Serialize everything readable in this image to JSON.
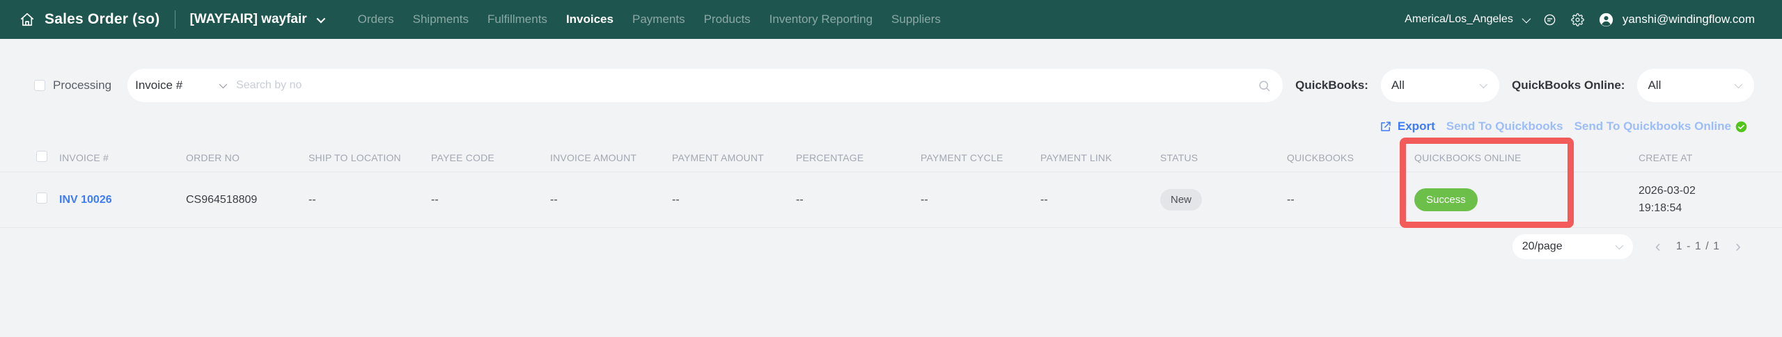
{
  "topbar": {
    "app_title": "Sales Order (so)",
    "store_selector": "[WAYFAIR] wayfair",
    "nav": [
      {
        "label": "Orders",
        "active": false
      },
      {
        "label": "Shipments",
        "active": false
      },
      {
        "label": "Fulfillments",
        "active": false
      },
      {
        "label": "Invoices",
        "active": true
      },
      {
        "label": "Payments",
        "active": false
      },
      {
        "label": "Products",
        "active": false
      },
      {
        "label": "Inventory Reporting",
        "active": false
      },
      {
        "label": "Suppliers",
        "active": false
      }
    ],
    "timezone": "America/Los_Angeles",
    "user_email": "yanshi@windingflow.com"
  },
  "filters": {
    "processing_label": "Processing",
    "search_type": "Invoice #",
    "search_placeholder": "Search by no",
    "quickbooks_label": "QuickBooks:",
    "quickbooks_value": "All",
    "quickbooks_online_label": "QuickBooks Online:",
    "quickbooks_online_value": "All"
  },
  "actions": {
    "export_label": "Export",
    "send_to_quickbooks_label": "Send To Quickbooks",
    "send_to_quickbooks_online_label": "Send To Quickbooks Online"
  },
  "table": {
    "columns": [
      "INVOICE #",
      "ORDER NO",
      "SHIP TO LOCATION",
      "PAYEE CODE",
      "INVOICE AMOUNT",
      "PAYMENT AMOUNT",
      "PERCENTAGE",
      "PAYMENT CYCLE",
      "PAYMENT LINK",
      "STATUS",
      "QUICKBOOKS",
      "QUICKBOOKS ONLINE",
      "CREATE AT"
    ],
    "rows": [
      {
        "invoice_no": "INV 10026",
        "order_no": "CS964518809",
        "ship_to_location": "--",
        "payee_code": "--",
        "invoice_amount": "--",
        "payment_amount": "--",
        "percentage": "--",
        "payment_cycle": "--",
        "payment_link": "--",
        "status": "New",
        "quickbooks": "--",
        "quickbooks_online": "Success",
        "create_at_date": "2026-03-02",
        "create_at_time": "19:18:54"
      }
    ]
  },
  "pagination": {
    "page_size": "20/page",
    "range": "1 - 1 / 1",
    "prev_icon": "‹",
    "next_icon": "›"
  },
  "colors": {
    "topbar_bg": "#1e564f",
    "accent_blue": "#3e7bfa",
    "disabled_blue": "#9cbdf8",
    "success_green": "#6cc04a",
    "check_green": "#52c41a",
    "highlight_red": "#f35b5b",
    "page_bg": "#f2f3f5"
  }
}
